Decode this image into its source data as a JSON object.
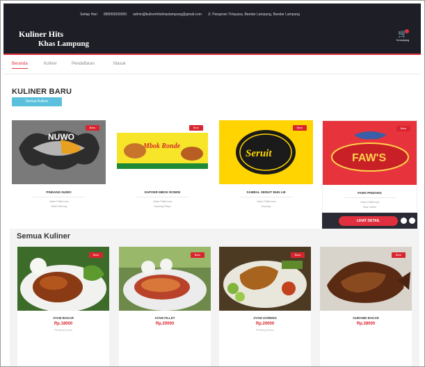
{
  "header": {
    "topbar": [
      "Setiap Hari",
      "089655000000",
      "admin@kulinerhitskhaslampung@gmail.com",
      "Jl. Pangeran Tirtayasa, Bandar Lampung, Bandar Lampung"
    ],
    "brand_line1": "Kuliner Hits",
    "brand_line2": "Khas Lampung",
    "cart_label": "Keranjang"
  },
  "nav": {
    "items": [
      "Beranda",
      "Kuliner",
      "Pendaftaran",
      "Masuk"
    ]
  },
  "kuliner_baru": {
    "title": "KULINER BARU",
    "button": "Semua Kuliner",
    "badge": "Baru",
    "cards": [
      {
        "name": "PINDANG NUWO",
        "info1": "Jalan Pattimura",
        "info2": "Teluk Betung",
        "logo_text": "NUWO"
      },
      {
        "name": "DAPOER MBOK RONDE",
        "info1": "Jalan Pattimura",
        "info2": "Kupang Raya",
        "logo_text": "Mbok Ronde"
      },
      {
        "name": "SAMBAL SERUIT BUN LIE",
        "info1": "Jalan Pattimura",
        "info2": "Kupang",
        "logo_text": "Seruit"
      },
      {
        "name": "FAWS PINDANG",
        "info1": "Jalan Pattimura",
        "info2": "Way Halim",
        "logo_text": "FAW'S"
      }
    ],
    "detail_button": "LIHAT DETAIL"
  },
  "semua_kuliner": {
    "title": "Semua Kuliner",
    "badge": "Baru",
    "cards": [
      {
        "name": "AYAM BAKAR",
        "price": "Rp.18000",
        "sub": "Pindang Nuwo"
      },
      {
        "name": "AYAM FILLET",
        "price": "Rp.20000",
        "sub": ""
      },
      {
        "name": "AYAM GORENG",
        "price": "Rp.20000",
        "sub": "Pindang Nuwo"
      },
      {
        "name": "GURAME BAKAR",
        "price": "Rp.38000",
        "sub": ""
      }
    ]
  },
  "colors": {
    "header_bg": "#1d1e26",
    "accent_red": "#e0303f",
    "button_blue": "#5bc0de",
    "badge_red": "#d9252f"
  }
}
